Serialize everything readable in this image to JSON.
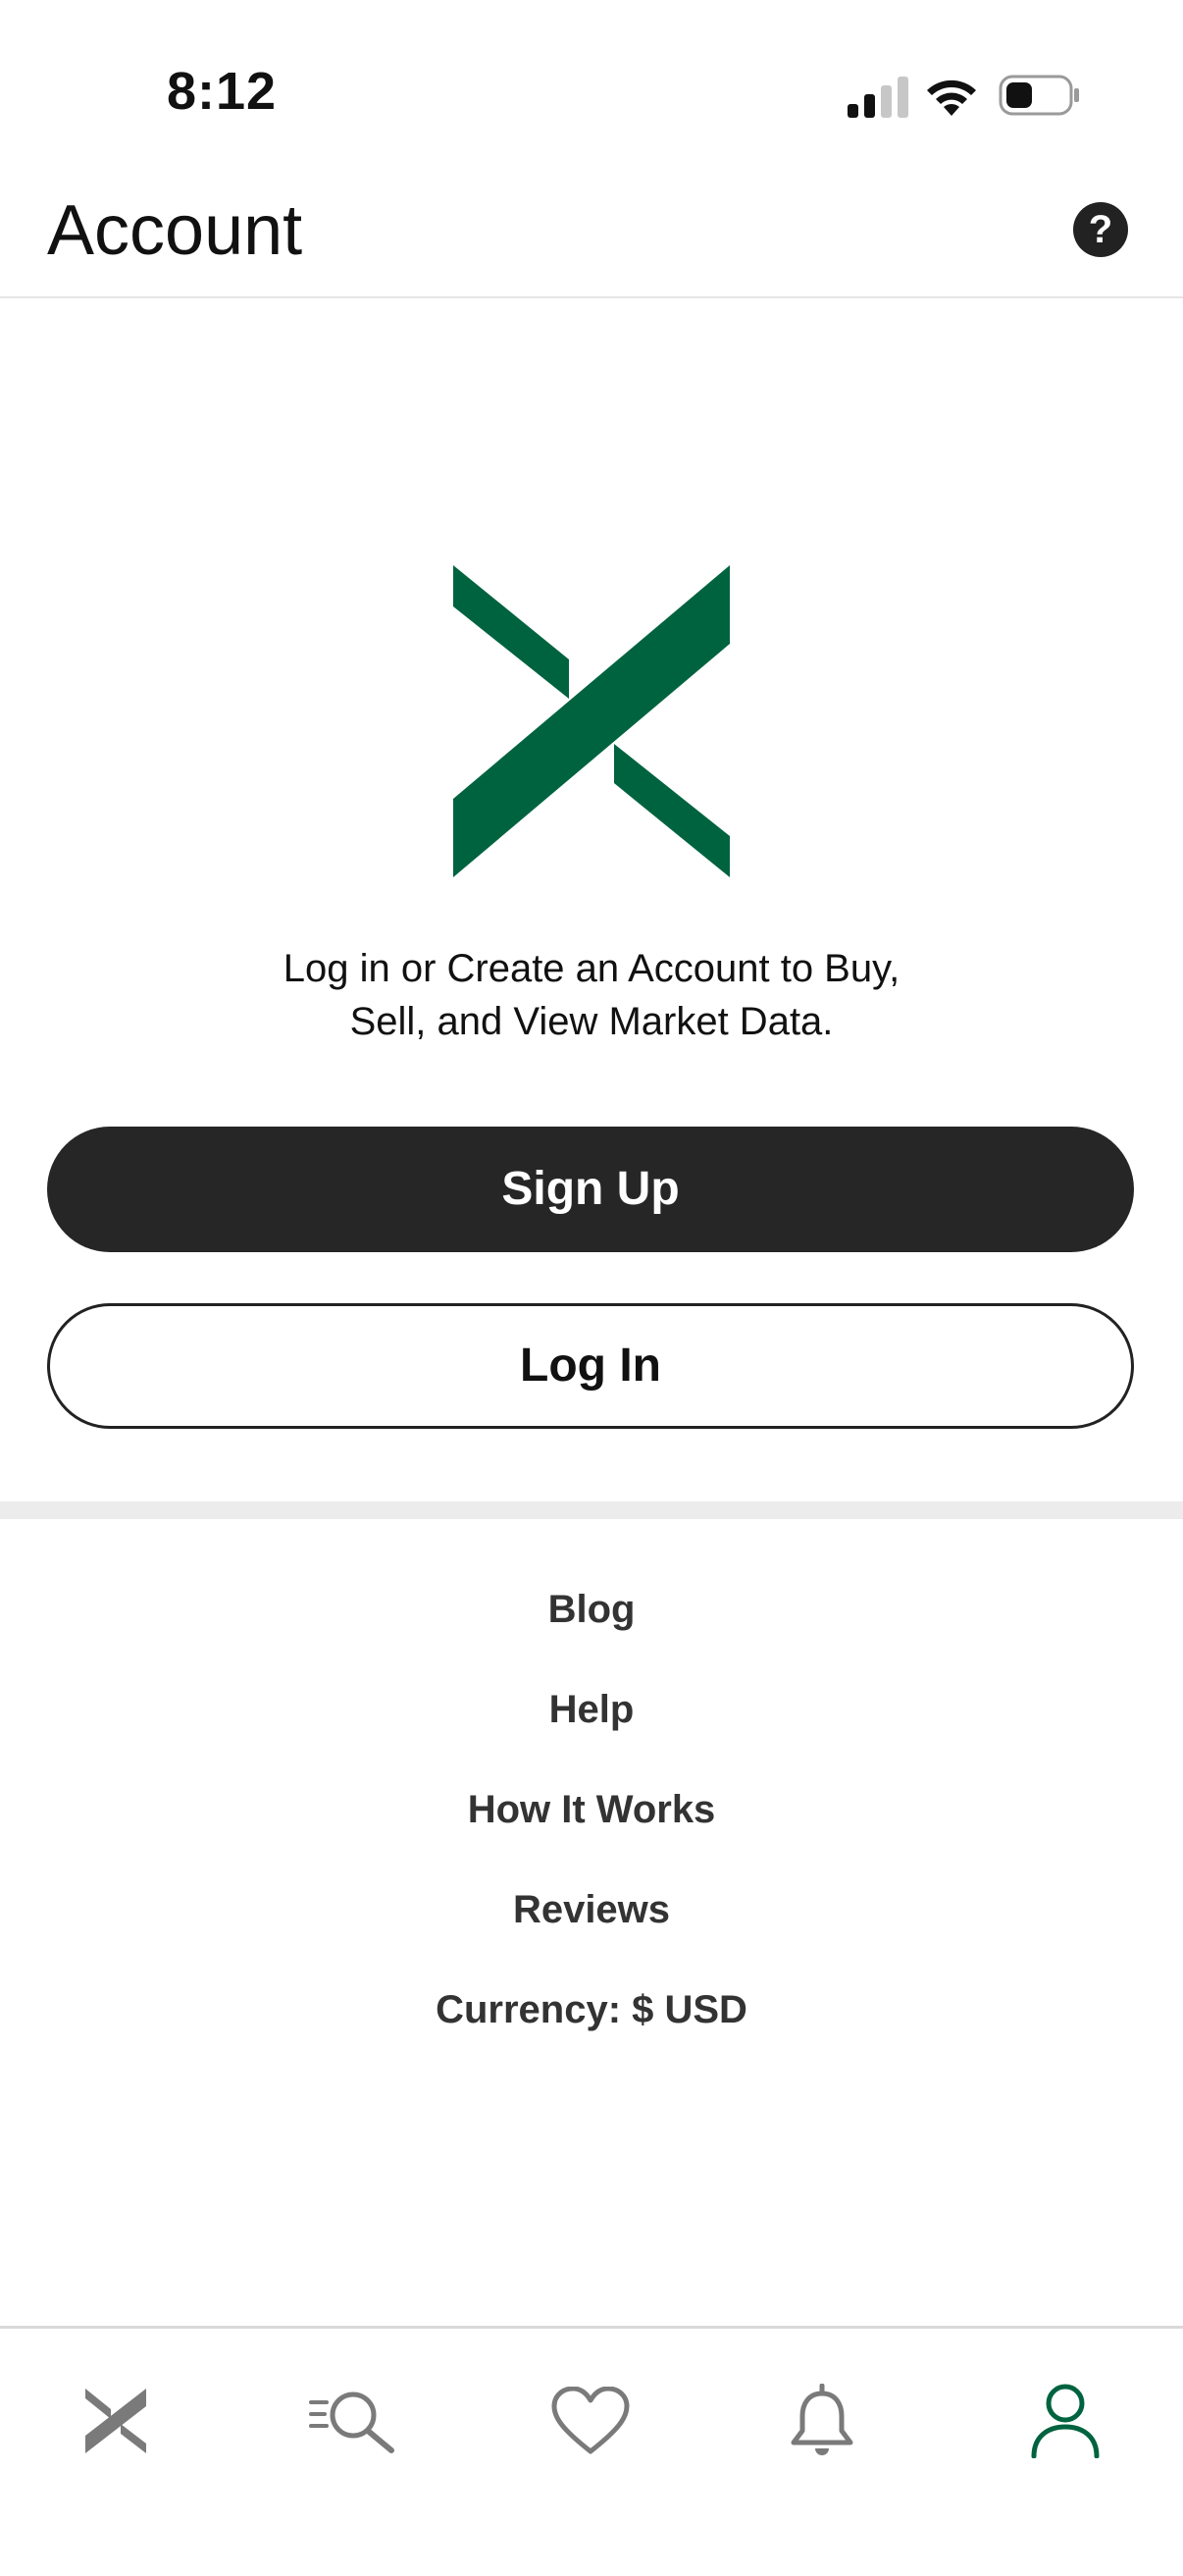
{
  "status_bar": {
    "time": "8:12"
  },
  "header": {
    "title": "Account",
    "help_icon_label": "?"
  },
  "main": {
    "tagline_line1": "Log in or Create an Account to Buy,",
    "tagline_line2": "Sell, and View Market Data.",
    "signup_label": "Sign Up",
    "login_label": "Log In",
    "brand_color": "#006340"
  },
  "links": [
    {
      "label": "Blog"
    },
    {
      "label": "Help"
    },
    {
      "label": "How It Works"
    },
    {
      "label": "Reviews"
    },
    {
      "label": "Currency: $ USD"
    }
  ],
  "tabbar": {
    "items": [
      {
        "icon": "home-x-icon",
        "active": false
      },
      {
        "icon": "search-icon",
        "active": false
      },
      {
        "icon": "heart-icon",
        "active": false
      },
      {
        "icon": "bell-icon",
        "active": false
      },
      {
        "icon": "profile-icon",
        "active": true
      }
    ],
    "active_color": "#006340",
    "inactive_color": "#7a7a7a"
  }
}
